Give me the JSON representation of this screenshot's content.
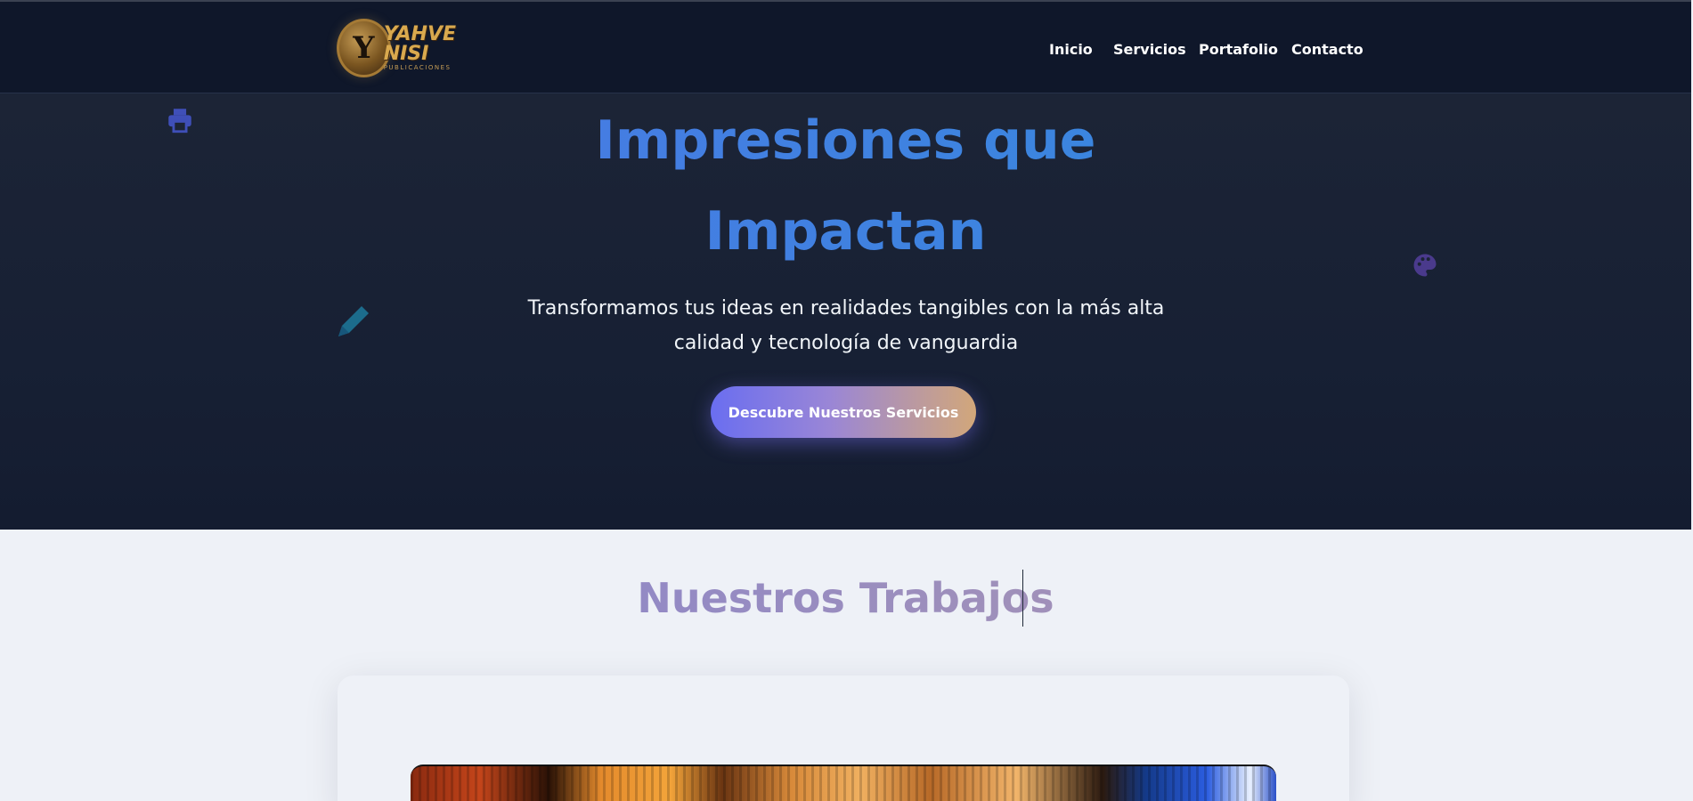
{
  "brand": {
    "logo_monogram": "Y",
    "logo_name": "YAHVE NISI",
    "logo_tagline": "PUBLICACIONES",
    "logo_alt": "Yahve Nisi logo"
  },
  "nav": {
    "items": [
      {
        "label": "Inicio"
      },
      {
        "label": "Servicios"
      },
      {
        "label": "Portafolio"
      },
      {
        "label": "Contacto"
      }
    ]
  },
  "hero": {
    "title_line1": "Impresiones que",
    "title_line2": "Impactan",
    "subtitle": "Transformamos tus ideas en realidades tangibles con la más alta calidad y tecnología de vanguardia",
    "cta_label": "Descubre Nuestros Servicios",
    "floating_icons": [
      "printer-icon",
      "palette-icon",
      "pen-icon"
    ]
  },
  "works": {
    "title": "Nuestros Trabajos"
  },
  "colors": {
    "nav_bg": "#0f172a",
    "hero_bg": "#1c2436",
    "title_gradient_start": "#5173e6",
    "title_gradient_end": "#2f8fdb",
    "cta_gradient_start": "#6a6ef0",
    "cta_gradient_end": "#d2a77a",
    "page_bg": "#eef1f7"
  }
}
